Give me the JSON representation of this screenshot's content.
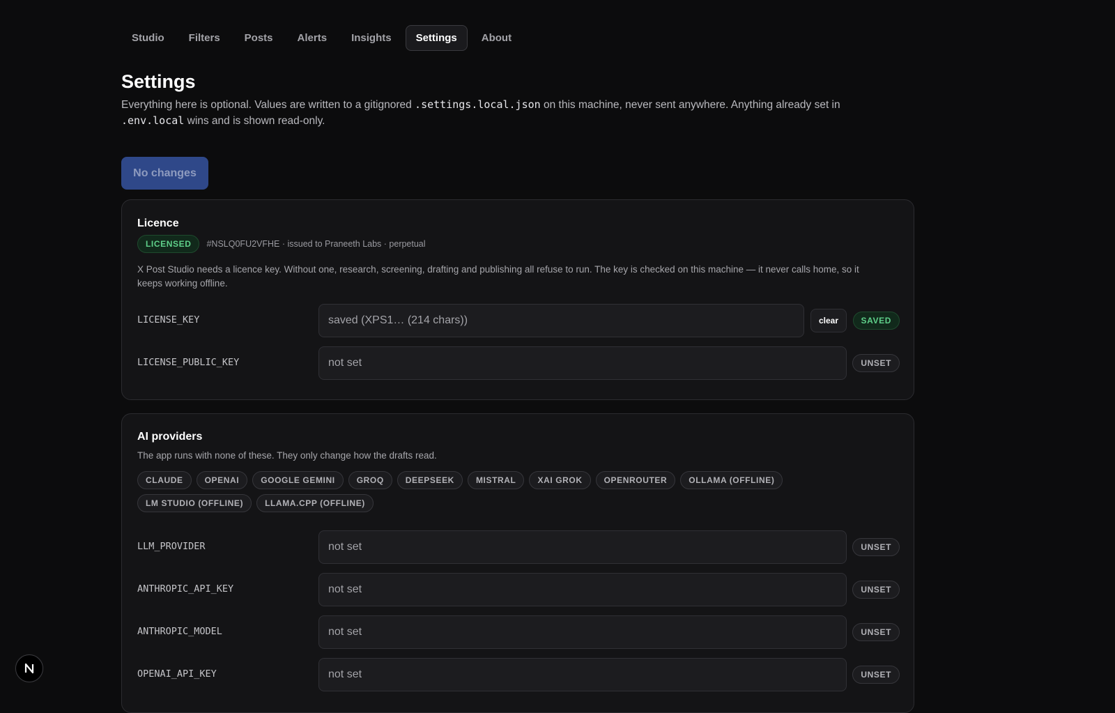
{
  "nav": {
    "tabs": [
      "Studio",
      "Filters",
      "Posts",
      "Alerts",
      "Insights",
      "Settings",
      "About"
    ]
  },
  "header": {
    "title": "Settings",
    "intro_1": "Everything here is optional. Values are written to a gitignored ",
    "intro_code_1": ".settings.local.json",
    "intro_2": " on this machine, never sent anywhere. Anything already set in ",
    "intro_code_2": ".env.local",
    "intro_3": " wins and is shown read-only."
  },
  "save_button": {
    "label": "No changes"
  },
  "licence": {
    "title": "Licence",
    "badge": "LICENSED",
    "meta": "#NSLQ0FU2VFHE · issued to Praneeth Labs · perpetual",
    "description": "X Post Studio needs a licence key. Without one, research, screening, drafting and publishing all refuse to run. The key is checked on this machine — it never calls home, so it keeps working offline.",
    "rows": [
      {
        "key": "LICENSE_KEY",
        "value": "saved (XPS1… (214 chars))",
        "action": "clear",
        "status": "SAVED"
      },
      {
        "key": "LICENSE_PUBLIC_KEY",
        "value": "not set",
        "status": "UNSET"
      }
    ]
  },
  "ai": {
    "title": "AI providers",
    "description": "The app runs with none of these. They only change how the drafts read.",
    "providers": [
      "CLAUDE",
      "OPENAI",
      "GOOGLE GEMINI",
      "GROQ",
      "DEEPSEEK",
      "MISTRAL",
      "XAI GROK",
      "OPENROUTER",
      "OLLAMA (OFFLINE)",
      "LM STUDIO (OFFLINE)",
      "LLAMA.CPP (OFFLINE)"
    ],
    "rows": [
      {
        "key": "LLM_PROVIDER",
        "value": "not set",
        "status": "UNSET"
      },
      {
        "key": "ANTHROPIC_API_KEY",
        "value": "not set",
        "status": "UNSET"
      },
      {
        "key": "ANTHROPIC_MODEL",
        "value": "not set",
        "status": "UNSET"
      },
      {
        "key": "OPENAI_API_KEY",
        "value": "not set",
        "status": "UNSET"
      }
    ]
  },
  "dev_badge": {
    "label": "N"
  }
}
